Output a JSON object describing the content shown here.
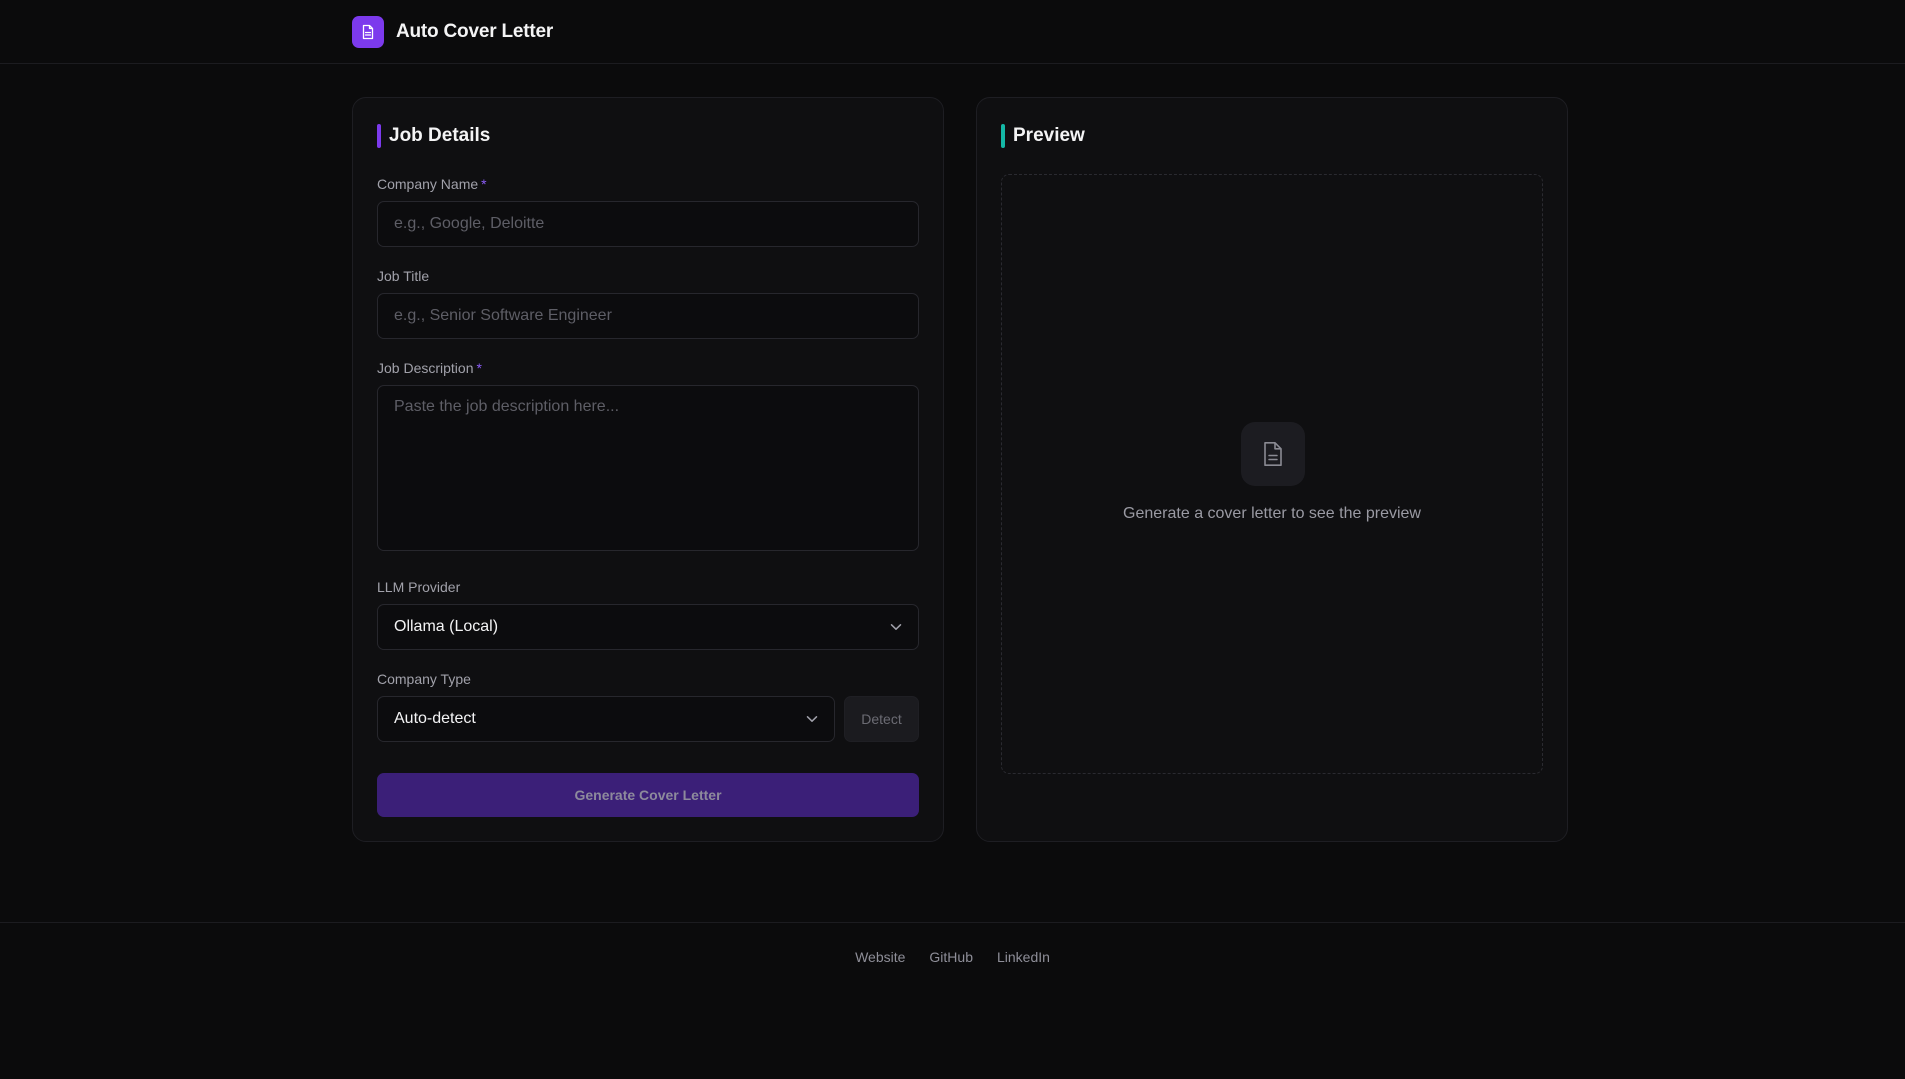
{
  "header": {
    "title": "Auto Cover Letter",
    "logo_icon": "document-icon",
    "logo_color": "#7c3aed"
  },
  "job_details": {
    "title": "Job Details",
    "accent_color": "#7c3aed",
    "company_name": {
      "label": "Company Name",
      "required_mark": "*",
      "value": "",
      "placeholder": "e.g., Google, Deloitte"
    },
    "job_title": {
      "label": "Job Title",
      "value": "",
      "placeholder": "e.g., Senior Software Engineer"
    },
    "job_description": {
      "label": "Job Description",
      "required_mark": "*",
      "value": "",
      "placeholder": "Paste the job description here..."
    },
    "llm_provider": {
      "label": "LLM Provider",
      "selected": "Ollama (Local)"
    },
    "company_type": {
      "label": "Company Type",
      "selected": "Auto-detect",
      "detect_label": "Detect"
    },
    "generate_label": "Generate Cover Letter"
  },
  "preview": {
    "title": "Preview",
    "accent_color": "#14b8a6",
    "empty_icon": "document-icon",
    "empty_message": "Generate a cover letter to see the preview"
  },
  "footer": {
    "links": [
      "Website",
      "GitHub",
      "LinkedIn"
    ]
  }
}
